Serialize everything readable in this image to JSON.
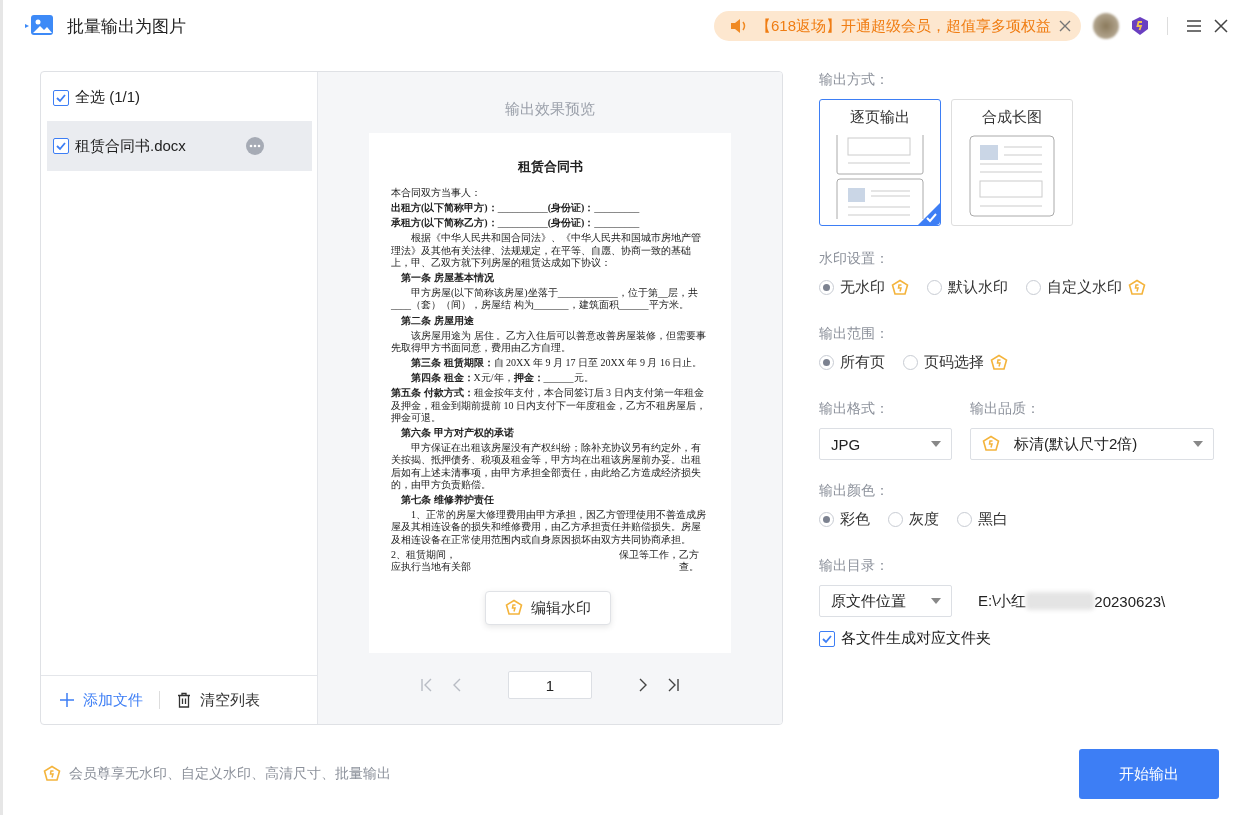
{
  "window": {
    "title": "批量输出为图片"
  },
  "promo": {
    "text": "【618返场】开通超级会员，超值享多项权益"
  },
  "file_list": {
    "select_all": {
      "label": "全选 (1/1)",
      "checked": true
    },
    "files": [
      {
        "name": "租赁合同书.docx",
        "checked": true,
        "selected": true
      }
    ],
    "add_button": "添加文件",
    "clear_button": "清空列表"
  },
  "preview": {
    "title": "输出效果预览",
    "document": [
      {
        "kind": "title",
        "text": "租赁合同书"
      },
      {
        "kind": "plain",
        "text": "本合同双方当事人："
      },
      {
        "kind": "plain",
        "text": "**出租方(以下简称甲方)：**__________**(身份证)：**_________"
      },
      {
        "kind": "plain",
        "text": "**承租方(以下简称乙方)：**__________**(身份证)：**_________"
      },
      {
        "kind": "para",
        "text": "根据《中华人民共和国合同法》、《中华人民共和国城市房地产管理法》及其他有关法律、法规规定，在平等、自愿、协商一致的基础上，甲、乙双方就下列房屋的租赁达成如下协议："
      },
      {
        "kind": "heading",
        "text": "第一条 房屋基本情况"
      },
      {
        "kind": "para",
        "text": "甲方房屋(以下简称该房屋)坐落于____________，位于第__层，共____（套）（间），房屋结 构为_______，建筑面积______平方米。"
      },
      {
        "kind": "heading",
        "text": "第二条 房屋用途"
      },
      {
        "kind": "para",
        "text": "该房屋用途为 居住 。乙方入住后可以善意改善房屋装修，但需要事先取得甲方书面同意，费用由乙方自理。"
      },
      {
        "kind": "para",
        "text": "**第三条 租赁期限：**自 20XX 年 9 月 17 日至 20XX 年 9 月 16 日止。"
      },
      {
        "kind": "para",
        "text": "**第四条 租金：**X元/年，**押金：**______元。"
      },
      {
        "kind": "plain",
        "text": "**第五条 付款方式：**租金按年支付，本合同签订后 3 日内支付第一年租金及押金，租金到期前提前 10 日内支付下一年度租金，乙方不租房屋后，押金可退。"
      },
      {
        "kind": "heading",
        "text": "第六条 甲方对产权的承诺"
      },
      {
        "kind": "para",
        "text": "甲方保证在出租该房屋没有产权纠纷；除补充协议另有约定外，有关按揭、抵押债务、税项及租金等，甲方均在出租该房屋前办妥。出租后如有上述未清事项，由甲方承担全部责任，由此给乙方造成经济损失的，由甲方负责赔偿。"
      },
      {
        "kind": "heading",
        "text": "第七条 维修养护责任"
      },
      {
        "kind": "para",
        "text": "1、正常的房屋大修理费用由甲方承担，因乙方管理使用不善造成房屋及其相连设备的损失和维修费用，由乙方承担责任并赔偿损失。房屋及相连设备在正常使用范围内或自身原因损坏由双方共同协商承担。"
      },
      {
        "kind": "split",
        "left": "2、租赁期间，",
        "right": "保卫等工作，乙方"
      },
      {
        "kind": "split",
        "left": "应执行当地有关部",
        "right": "查。"
      }
    ],
    "watermark_button": "编辑水印",
    "pager": {
      "page": "1",
      "at_first": true,
      "at_last": false
    }
  },
  "settings": {
    "output_mode": {
      "label": "输出方式：",
      "options": [
        {
          "label": "逐页输出",
          "selected": true,
          "kind": "pages"
        },
        {
          "label": "合成长图",
          "selected": false,
          "kind": "long"
        }
      ]
    },
    "watermark": {
      "label": "水印设置：",
      "options": [
        {
          "label": "无水印",
          "selected": true,
          "vip": true
        },
        {
          "label": "默认水印",
          "selected": false,
          "vip": false
        },
        {
          "label": "自定义水印",
          "selected": false,
          "vip": true
        }
      ]
    },
    "range": {
      "label": "输出范围：",
      "options": [
        {
          "label": "所有页",
          "selected": true,
          "vip": false
        },
        {
          "label": "页码选择",
          "selected": false,
          "vip": true
        }
      ]
    },
    "format": {
      "label": "输出格式：",
      "value": "JPG"
    },
    "quality": {
      "label": "输出品质：",
      "value": "标清(默认尺寸2倍)",
      "vip": true
    },
    "color": {
      "label": "输出颜色：",
      "options": [
        {
          "label": "彩色",
          "selected": true
        },
        {
          "label": "灰度",
          "selected": false
        },
        {
          "label": "黑白",
          "selected": false
        }
      ]
    },
    "directory": {
      "label": "输出目录：",
      "value": "原文件位置",
      "path_start": "E:\\小红",
      "path_end": "20230623\\"
    },
    "subfolder": {
      "label": "各文件生成对应文件夹",
      "checked": true
    }
  },
  "footer": {
    "note": "会员尊享无水印、自定义水印、高清尺寸、批量输出",
    "start_button": "开始输出"
  }
}
